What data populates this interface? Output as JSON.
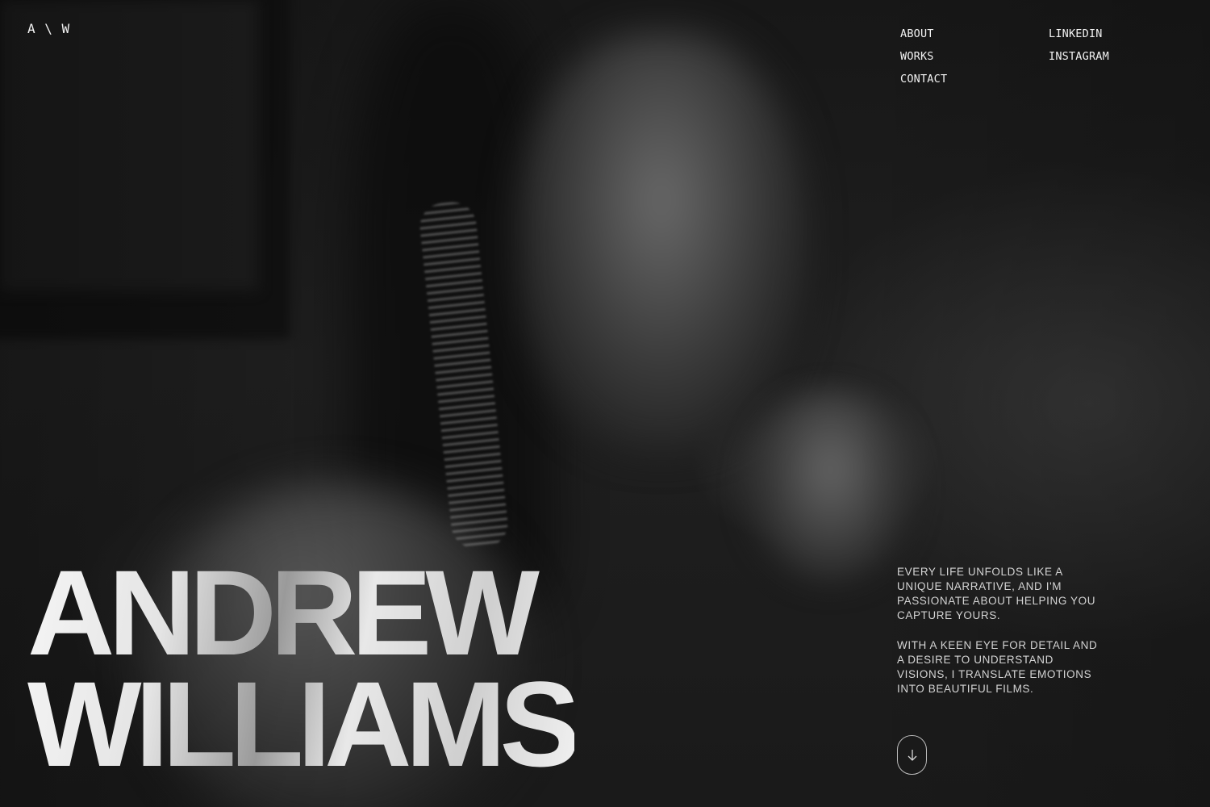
{
  "logo": "A \\ W",
  "nav": {
    "main": [
      "ABOUT",
      "WORKS",
      "CONTACT"
    ],
    "social": [
      "LINKEDIN",
      "INSTAGRAM"
    ]
  },
  "hero": {
    "first_name": "ANDREW",
    "last_name": "WILLIAMS"
  },
  "intro": {
    "paragraph_1": "EVERY LIFE UNFOLDS LIKE A UNIQUE NARRATIVE, AND I'M PASSIONATE ABOUT HELPING YOU CAPTURE YOURS.",
    "paragraph_2": "WITH A KEEN EYE FOR DETAIL AND A DESIRE TO UNDERSTAND VISIONS, I TRANSLATE EMOTIONS INTO BEAUTIFUL FILMS."
  },
  "scroll_button": {
    "icon": "arrow-down-icon"
  },
  "colors": {
    "background": "#1b1b1b",
    "text": "#f2f2f2",
    "muted_text": "#d4d4d4"
  }
}
